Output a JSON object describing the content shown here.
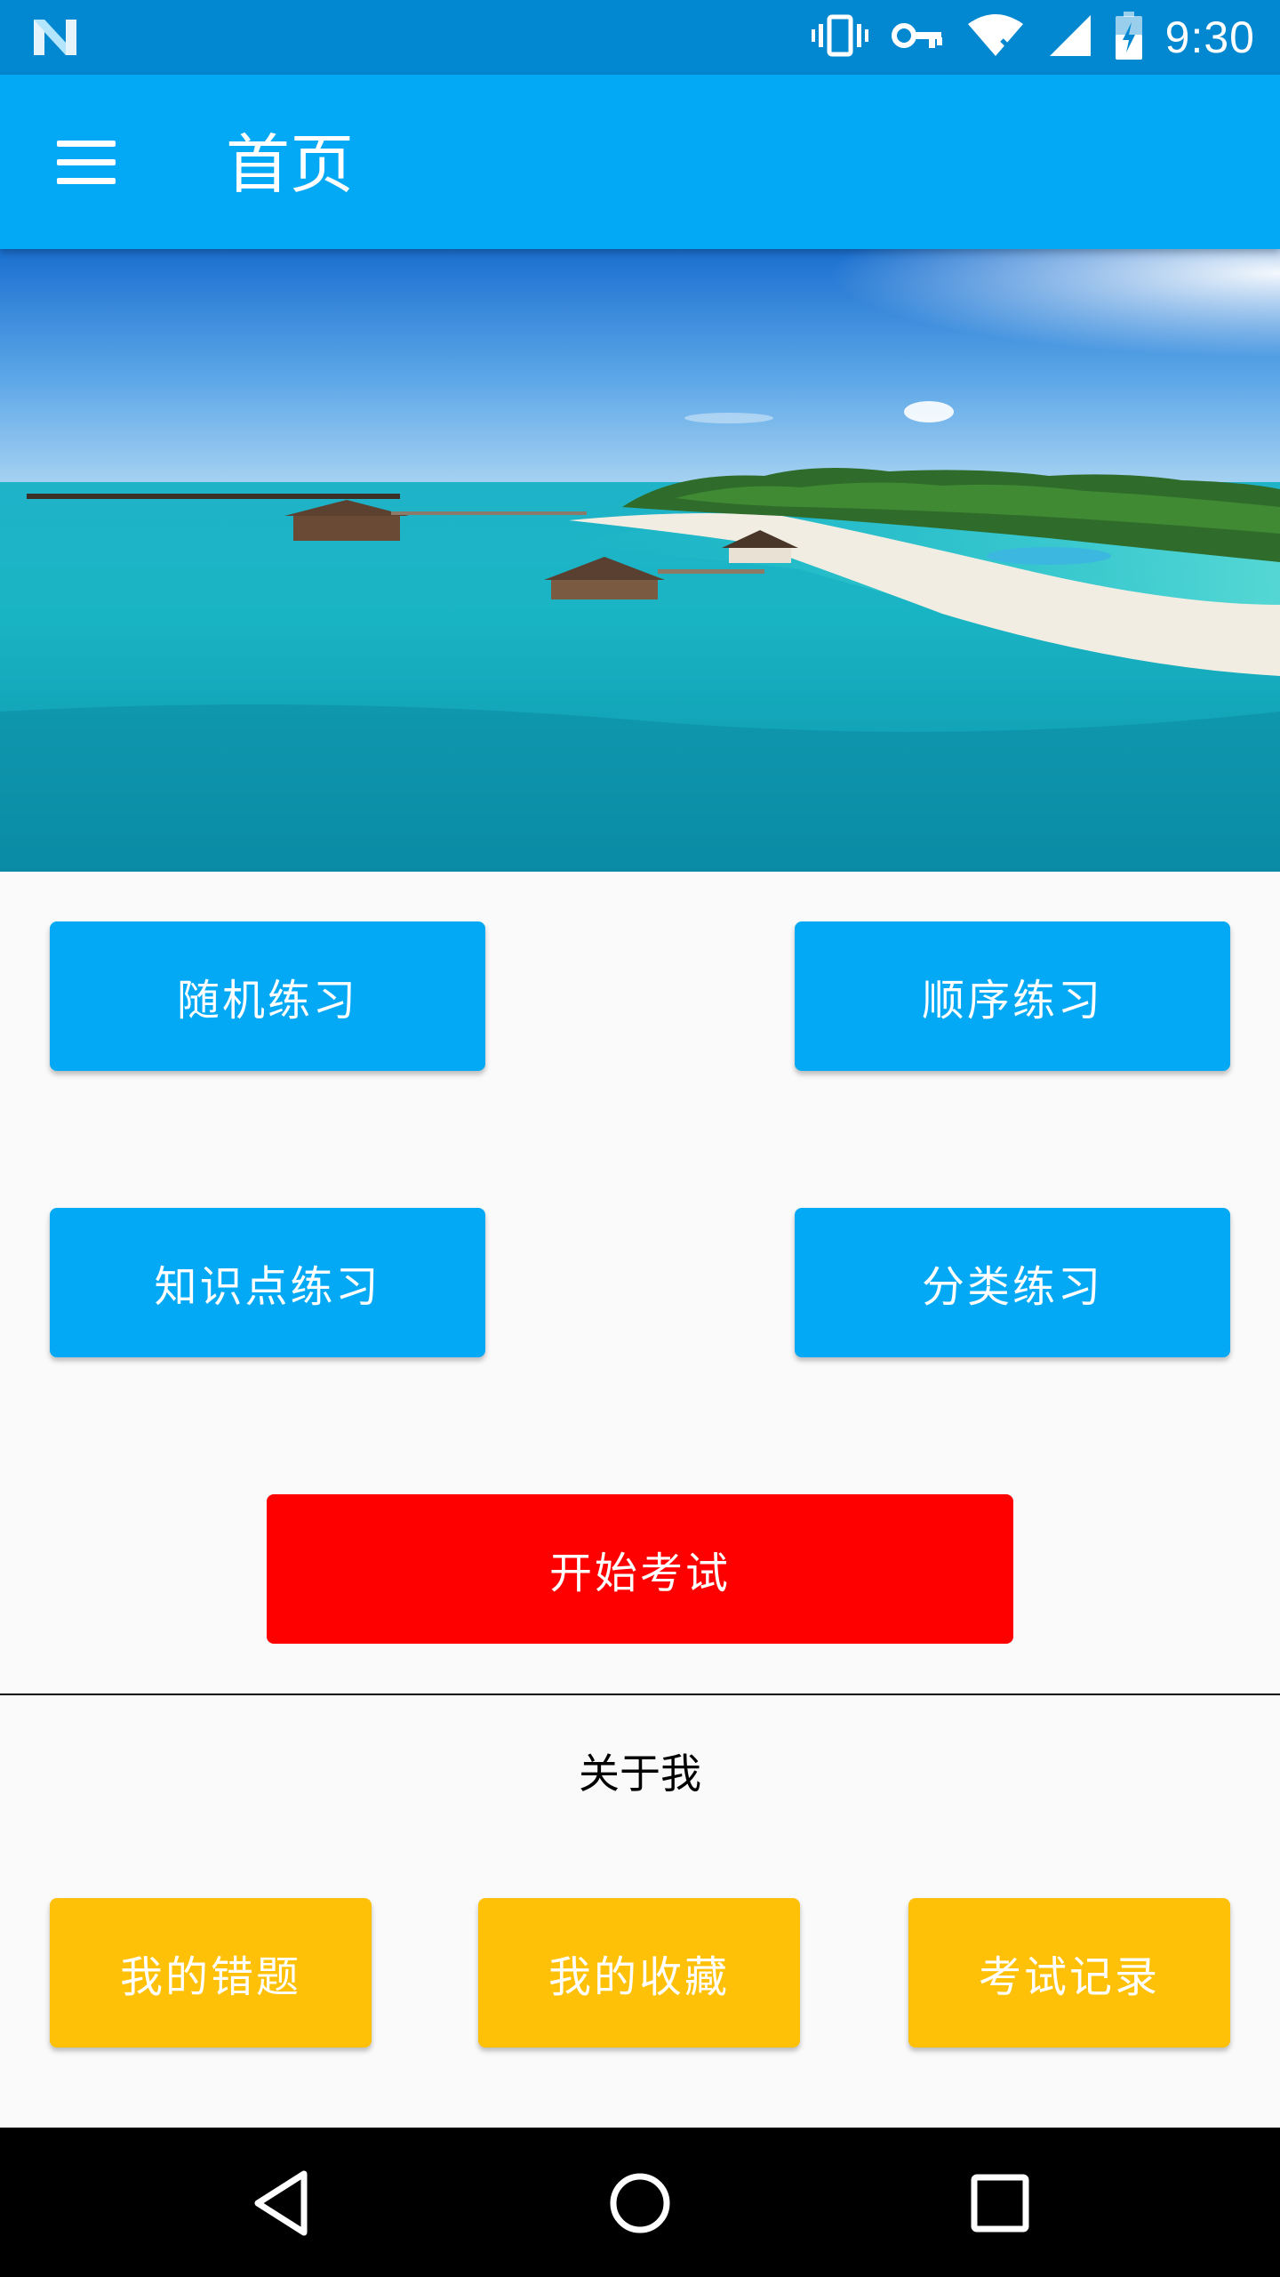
{
  "status_bar": {
    "time": "9:30",
    "icons": [
      "notification-n-icon",
      "vibrate-icon",
      "key-icon",
      "wifi-icon",
      "signal-icon",
      "battery-charging-icon"
    ]
  },
  "app_bar": {
    "title": "首页",
    "menu_icon": "menu-icon"
  },
  "banner": {
    "image": "tropical-island-photo"
  },
  "practice_buttons": {
    "random": "随机练习",
    "sequential": "顺序练习",
    "knowledge": "知识点练习",
    "category": "分类练习"
  },
  "exam_button": "开始考试",
  "about": {
    "title": "关于我",
    "mistakes": "我的错题",
    "favorites": "我的收藏",
    "records": "考试记录"
  },
  "colors": {
    "status_bar": "#0288d1",
    "app_bar": "#03a9f4",
    "primary_button": "#03a9f4",
    "exam_button": "#ff0000",
    "about_button": "#ffc107"
  },
  "nav_bar": {
    "icons": [
      "back-icon",
      "home-icon",
      "recents-icon"
    ]
  }
}
